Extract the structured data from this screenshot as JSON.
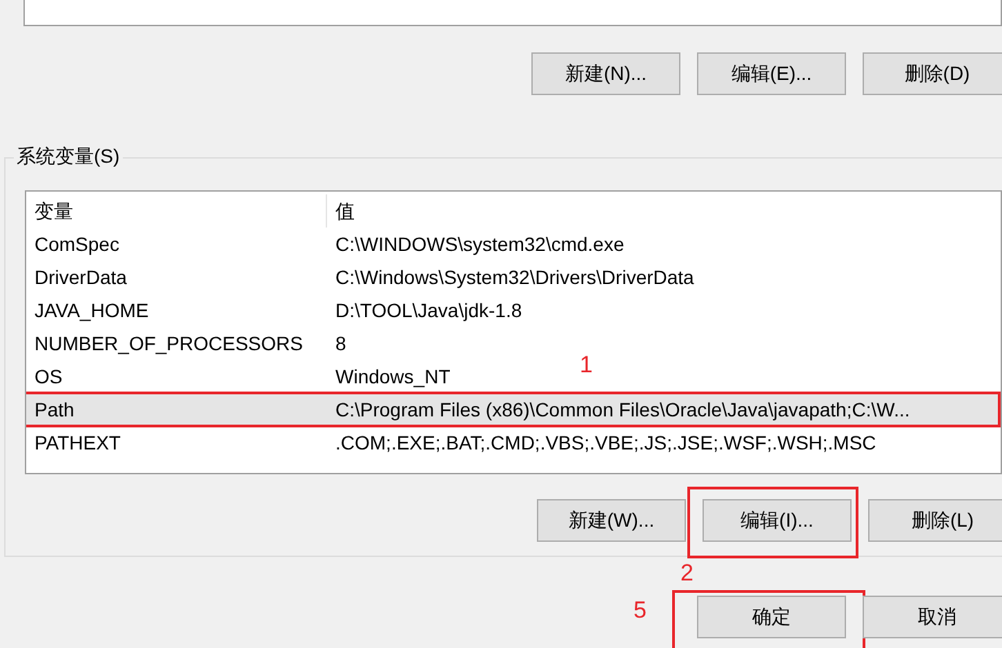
{
  "user_variables": {
    "buttons": [
      {
        "label": "新建(N)..."
      },
      {
        "label": "编辑(E)..."
      },
      {
        "label": "删除(D)"
      }
    ]
  },
  "system_variables": {
    "label": "系统变量(S)",
    "columns": [
      "变量",
      "值"
    ],
    "rows": [
      {
        "name": "ComSpec",
        "value": "C:\\WINDOWS\\system32\\cmd.exe",
        "selected": false
      },
      {
        "name": "DriverData",
        "value": "C:\\Windows\\System32\\Drivers\\DriverData",
        "selected": false
      },
      {
        "name": "JAVA_HOME",
        "value": "D:\\TOOL\\Java\\jdk-1.8",
        "selected": false
      },
      {
        "name": "NUMBER_OF_PROCESSORS",
        "value": "8",
        "selected": false
      },
      {
        "name": "OS",
        "value": "Windows_NT",
        "selected": false
      },
      {
        "name": "Path",
        "value": "C:\\Program Files (x86)\\Common Files\\Oracle\\Java\\javapath;C:\\W...",
        "selected": true,
        "highlighted": true,
        "callout": "1"
      },
      {
        "name": "PATHEXT",
        "value": ".COM;.EXE;.BAT;.CMD;.VBS;.VBE;.JS;.JSE;.WSF;.WSH;.MSC",
        "selected": false
      }
    ],
    "buttons": [
      {
        "label": "新建(W)..."
      },
      {
        "label": "编辑(I)...",
        "highlighted": true,
        "callout": "2"
      },
      {
        "label": "删除(L)"
      }
    ]
  },
  "dialog_buttons": [
    {
      "label": "确定",
      "highlighted": true,
      "callout": "5"
    },
    {
      "label": "取消"
    }
  ]
}
